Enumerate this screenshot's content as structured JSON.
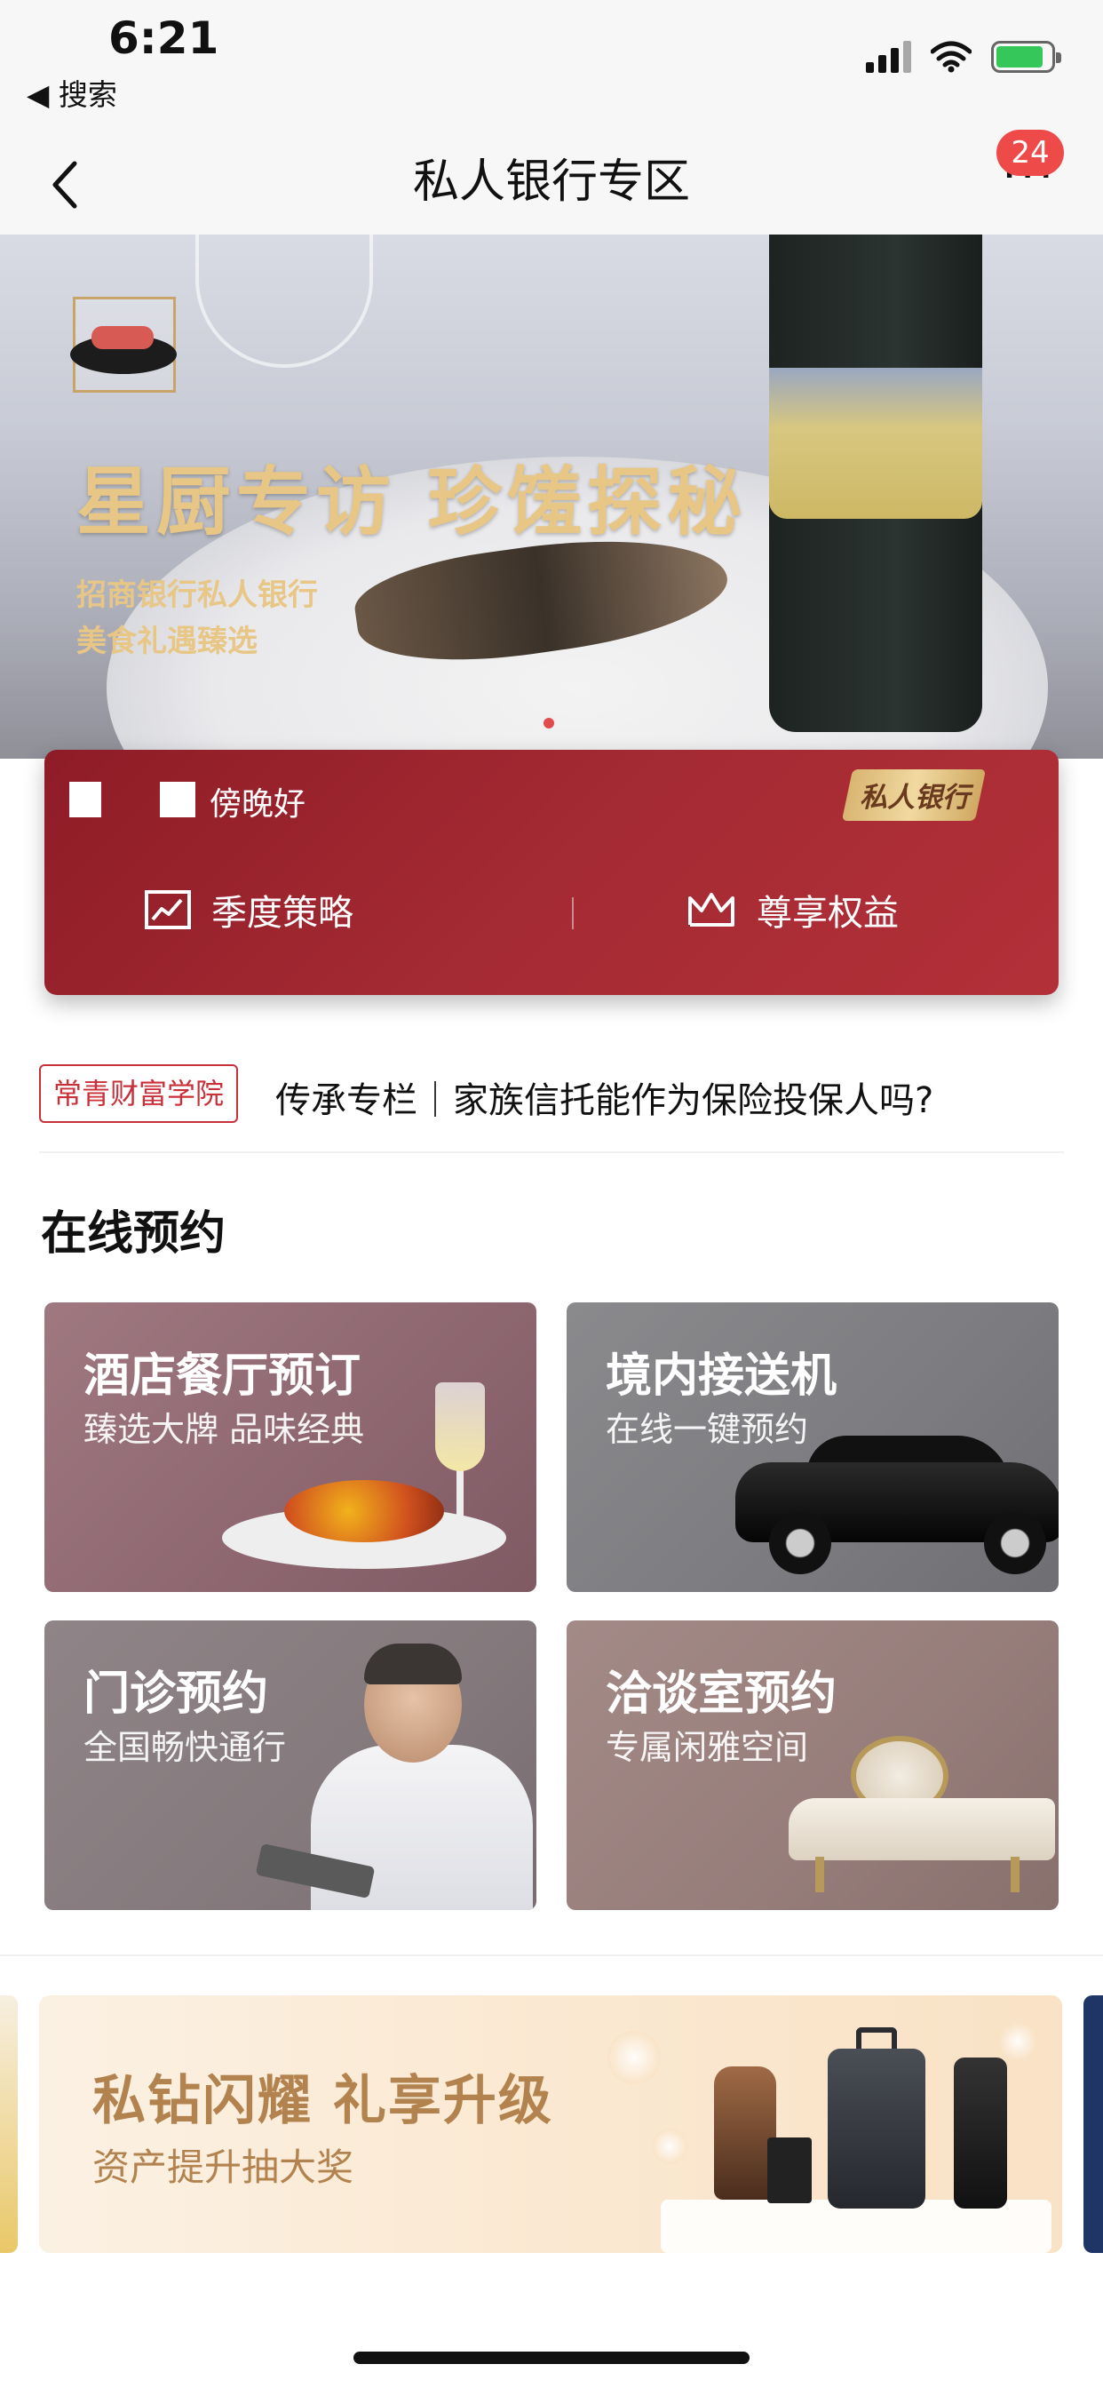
{
  "status_bar": {
    "time": "6:21",
    "back_app": "◀ 搜索"
  },
  "nav": {
    "title": "私人银行专区",
    "more": "···",
    "badge": "24"
  },
  "banner": {
    "title": "星厨专访 珍馐探秘",
    "sub_line1": "招商银行私人银行",
    "sub_line2": "美食礼遇臻选"
  },
  "card": {
    "greeting": "傍晚好",
    "badge": "私人银行",
    "items": [
      {
        "label": "季度策略",
        "icon": "chart-icon"
      },
      {
        "label": "尊享权益",
        "icon": "crown-icon"
      }
    ]
  },
  "academy": {
    "tag": "常青财富学院",
    "text": "传承专栏｜家族信托能作为保险投保人吗?"
  },
  "online_booking": {
    "title": "在线预约",
    "tiles": [
      {
        "title": "酒店餐厅预订",
        "subtitle": "臻选大牌 品味经典"
      },
      {
        "title": "境内接送机",
        "subtitle": "在线一键预约"
      },
      {
        "title": "门诊预约",
        "subtitle": "全国畅快通行"
      },
      {
        "title": "洽谈室预约",
        "subtitle": "专属闲雅空间"
      }
    ]
  },
  "promo": {
    "title": "私钻闪耀 礼享升级",
    "subtitle": "资产提升抽大奖"
  },
  "colors": {
    "card_red": "#a42a33",
    "accent_gold": "#e8c685",
    "promo_text": "#b2834f"
  }
}
